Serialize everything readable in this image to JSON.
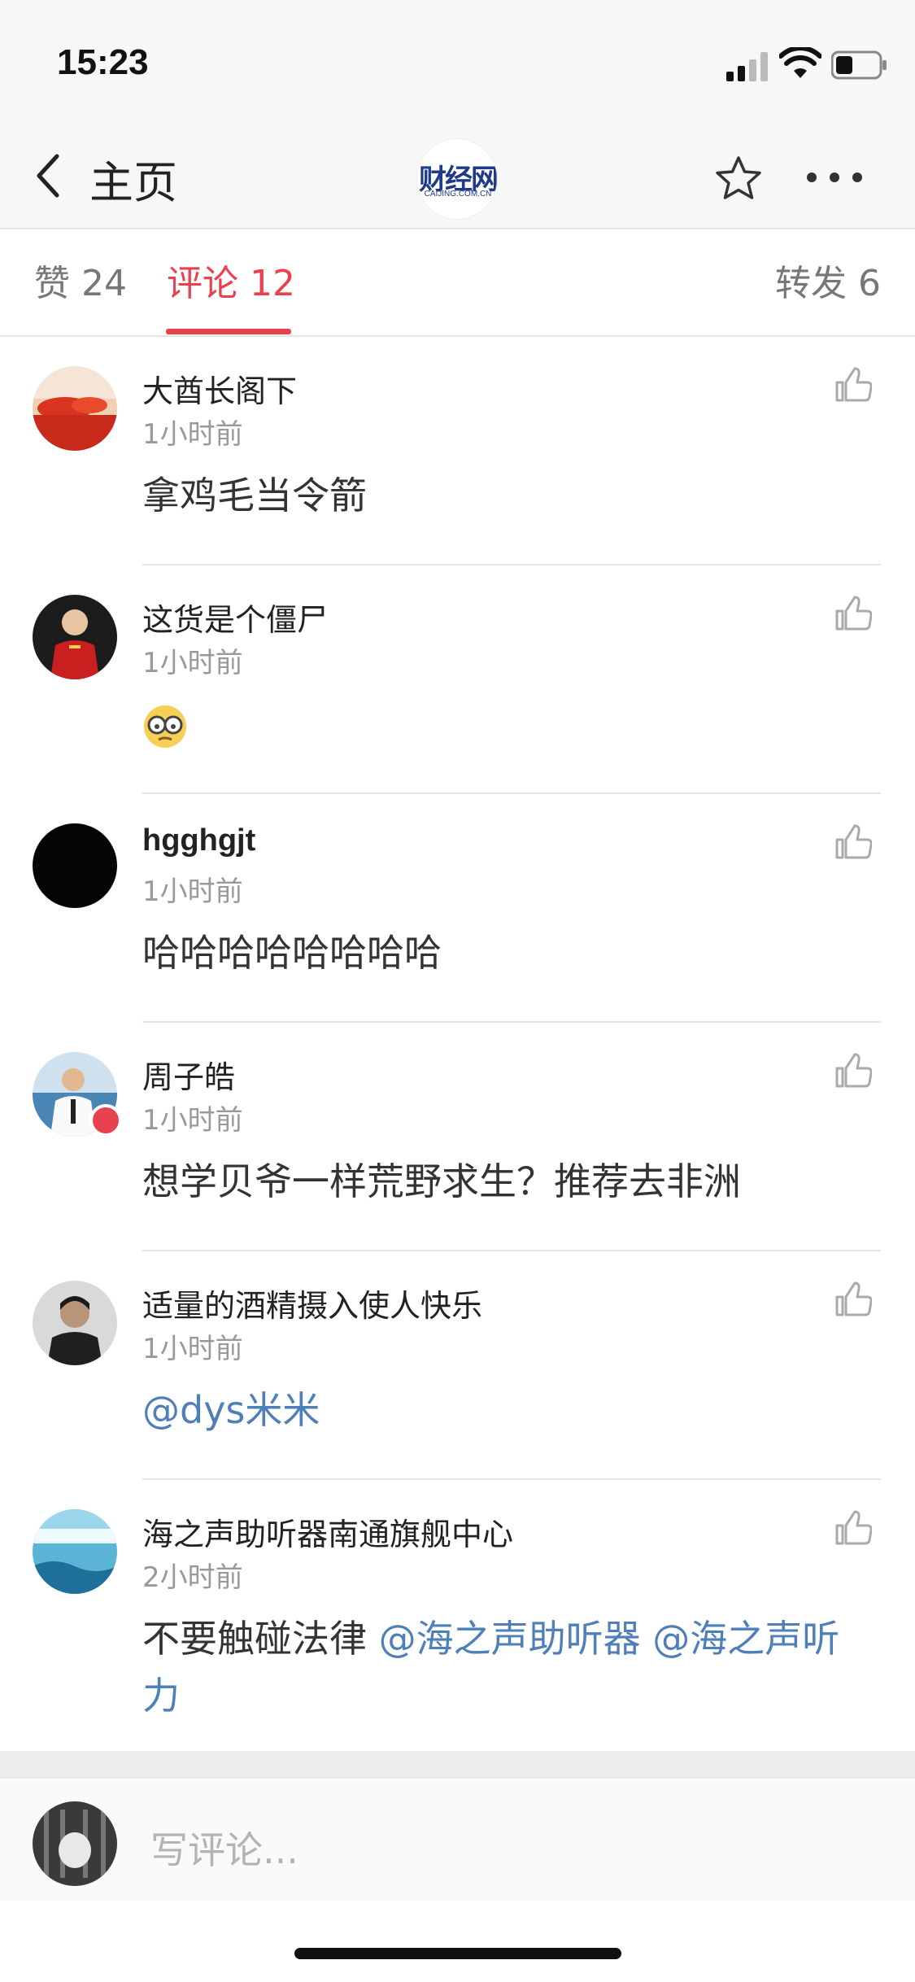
{
  "status": {
    "time": "15:23"
  },
  "nav": {
    "back_label": "主页",
    "logo_text": "财经网",
    "logo_sub": "CAIJING.COM.CN"
  },
  "tabs": {
    "likes": "赞 24",
    "comments": "评论 12",
    "reposts": "转发 6"
  },
  "comments": [
    {
      "name": "大酋长阁下",
      "time": "1小时前",
      "text": "拿鸡毛当令箭"
    },
    {
      "name": "这货是个僵尸",
      "time": "1小时前",
      "text": ""
    },
    {
      "name": "hgghgjt",
      "time": "1小时前",
      "text": "哈哈哈哈哈哈哈哈"
    },
    {
      "name": "周子皓",
      "time": "1小时前",
      "text": "想学贝爷一样荒野求生？推荐去非洲"
    },
    {
      "name": "适量的酒精摄入使人快乐",
      "time": "1小时前",
      "mention": "@dys米米"
    },
    {
      "name": "海之声助听器南通旗舰中心",
      "time": "2小时前",
      "text": "不要触碰法律 ",
      "mention1": "@海之声助听器",
      "mention2": "@海之声听力"
    }
  ],
  "composer": {
    "placeholder": "写评论..."
  },
  "colors": {
    "accent": "#e8414f",
    "mention": "#4f7fb8"
  }
}
